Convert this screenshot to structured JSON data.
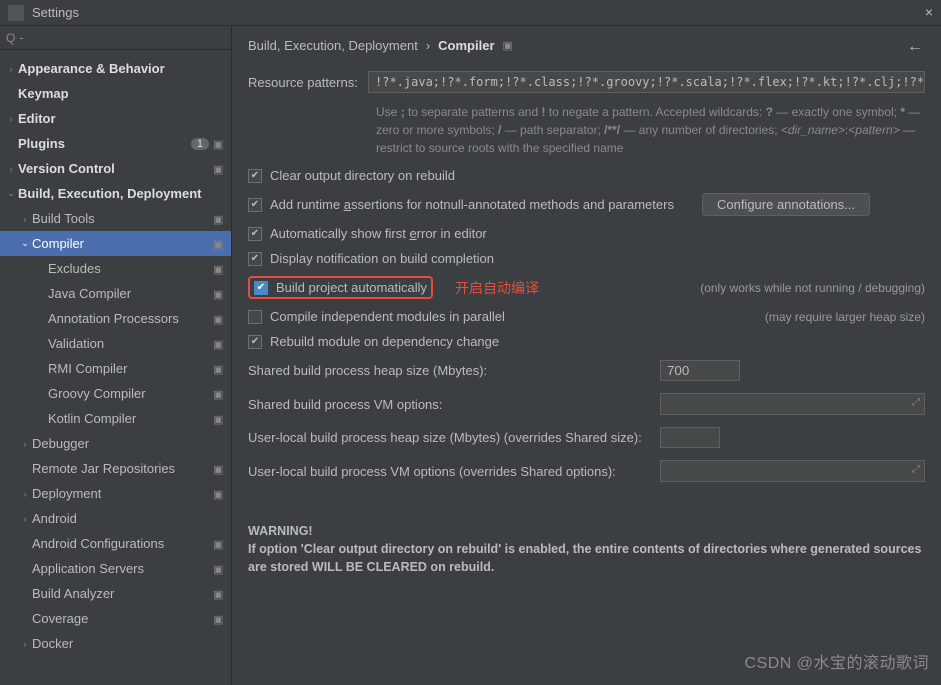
{
  "window": {
    "title": "Settings",
    "close": "×"
  },
  "search": {
    "placeholder": ""
  },
  "sidebar": {
    "items": [
      {
        "label": "Appearance & Behavior",
        "arrow": "›",
        "bold": true,
        "indent": 0,
        "reset": false
      },
      {
        "label": "Keymap",
        "arrow": "",
        "bold": true,
        "indent": 0,
        "reset": false,
        "pad": true
      },
      {
        "label": "Editor",
        "arrow": "›",
        "bold": true,
        "indent": 0,
        "reset": false
      },
      {
        "label": "Plugins",
        "arrow": "",
        "bold": true,
        "indent": 0,
        "reset": true,
        "badge": "1",
        "pad": true
      },
      {
        "label": "Version Control",
        "arrow": "›",
        "bold": true,
        "indent": 0,
        "reset": true
      },
      {
        "label": "Build, Execution, Deployment",
        "arrow": "⌄",
        "bold": true,
        "indent": 0,
        "reset": false
      },
      {
        "label": "Build Tools",
        "arrow": "›",
        "indent": 1,
        "reset": true
      },
      {
        "label": "Compiler",
        "arrow": "⌄",
        "indent": 1,
        "reset": true,
        "selected": true
      },
      {
        "label": "Excludes",
        "arrow": "",
        "indent": 2,
        "reset": true
      },
      {
        "label": "Java Compiler",
        "arrow": "",
        "indent": 2,
        "reset": true
      },
      {
        "label": "Annotation Processors",
        "arrow": "",
        "indent": 2,
        "reset": true
      },
      {
        "label": "Validation",
        "arrow": "",
        "indent": 2,
        "reset": true
      },
      {
        "label": "RMI Compiler",
        "arrow": "",
        "indent": 2,
        "reset": true
      },
      {
        "label": "Groovy Compiler",
        "arrow": "",
        "indent": 2,
        "reset": true
      },
      {
        "label": "Kotlin Compiler",
        "arrow": "",
        "indent": 2,
        "reset": true
      },
      {
        "label": "Debugger",
        "arrow": "›",
        "indent": 1,
        "reset": false
      },
      {
        "label": "Remote Jar Repositories",
        "arrow": "",
        "indent": 1,
        "reset": true,
        "pad": true
      },
      {
        "label": "Deployment",
        "arrow": "›",
        "indent": 1,
        "reset": true
      },
      {
        "label": "Android",
        "arrow": "›",
        "indent": 1,
        "reset": false
      },
      {
        "label": "Android Configurations",
        "arrow": "",
        "indent": 1,
        "reset": true,
        "pad": true
      },
      {
        "label": "Application Servers",
        "arrow": "",
        "indent": 1,
        "reset": true,
        "pad": true
      },
      {
        "label": "Build Analyzer",
        "arrow": "",
        "indent": 1,
        "reset": true,
        "pad": true
      },
      {
        "label": "Coverage",
        "arrow": "",
        "indent": 1,
        "reset": true,
        "pad": true
      },
      {
        "label": "Docker",
        "arrow": "›",
        "indent": 1,
        "reset": false
      }
    ]
  },
  "breadcrumb": {
    "a": "Build, Execution, Deployment",
    "sep": "›",
    "b": "Compiler"
  },
  "resource": {
    "label": "Resource patterns:",
    "value": "!?*.java;!?*.form;!?*.class;!?*.groovy;!?*.scala;!?*.flex;!?*.kt;!?*.clj;!?*.",
    "hint": "Use ; to separate patterns and ! to negate a pattern. Accepted wildcards: ? — exactly one symbol; * — zero or more symbols; / — path separator; /**/ — any number of directories; <dir_name>:<pattern> — restrict to source roots with the specified name"
  },
  "checks": {
    "clear": "Clear output directory on rebuild",
    "runtime_pre": "Add runtime ",
    "runtime_u": "a",
    "runtime_post": "ssertions for notnull-annotated methods and parameters",
    "configure": "Configure annotations...",
    "auto_err": "Automatically show first error in editor",
    "auto_err_u": "e",
    "notify": "Display notification on build completion",
    "build_auto": "Build project automatically",
    "build_auto_note": "(only works while not running / debugging)",
    "annotation": "开启自动编译",
    "parallel": "Compile independent modules in parallel",
    "parallel_note": "(may require larger heap size)",
    "rebuild": "Rebuild module on dependency change"
  },
  "fields": {
    "heap": "Shared build process heap size (Mbytes):",
    "heap_val": "700",
    "vm": "Shared build process VM options:",
    "uheap": "User-local build process heap size (Mbytes) (overrides Shared size):",
    "uvm": "User-local build process VM options (overrides Shared options):"
  },
  "warning": {
    "title": "WARNING!",
    "line1": "If option 'Clear output directory on rebuild' is enabled, the entire contents of directories where generated sources are stored WILL BE CLEARED on rebuild."
  },
  "watermark": "CSDN @水宝的滚动歌词"
}
